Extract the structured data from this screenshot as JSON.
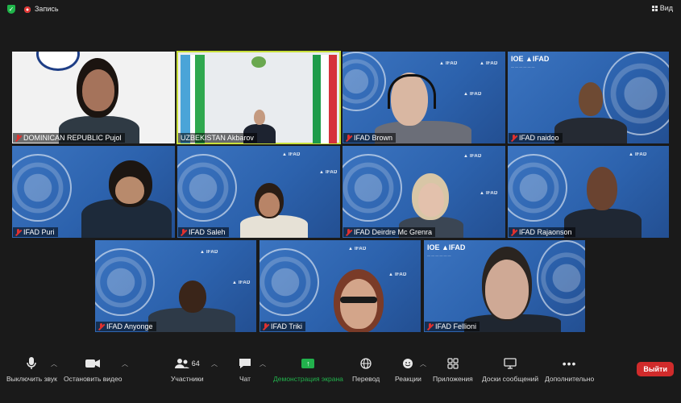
{
  "topbar": {
    "recording_label": "Запись",
    "view_label": "Вид"
  },
  "participants": [
    {
      "name": "DOMINICAN REPUBLIC Pujol",
      "muted": true
    },
    {
      "name": "UZBEKISTAN Akbarov",
      "muted": false,
      "active_speaker": true
    },
    {
      "name": "IFAD Brown",
      "muted": true
    },
    {
      "name": "IFAD naidoo",
      "muted": true
    },
    {
      "name": "IFAD Puri",
      "muted": true
    },
    {
      "name": "IFAD Saleh",
      "muted": true
    },
    {
      "name": "IFAD Deirdre Mc Grenra",
      "muted": true
    },
    {
      "name": "IFAD Rajaonson",
      "muted": true
    },
    {
      "name": "IFAD Anyonge",
      "muted": true
    },
    {
      "name": "IFAD Triki",
      "muted": true
    },
    {
      "name": "IFAD Fellioni",
      "muted": true
    }
  ],
  "toolbar": {
    "mute_label": "Выключить звук",
    "video_label": "Остановить видео",
    "participants_label": "Участники",
    "participants_count": "64",
    "chat_label": "Чат",
    "share_label": "Демонстрация экрана",
    "translate_label": "Перевод",
    "reactions_label": "Реакции",
    "apps_label": "Приложения",
    "whiteboards_label": "Доски сообщений",
    "more_label": "Дополнительно",
    "leave_label": "Выйти"
  },
  "colors": {
    "active_speaker_border": "#c9e03a",
    "share_green": "#22b14c",
    "leave_red": "#d02b2b",
    "mute_red": "#e0312f"
  }
}
